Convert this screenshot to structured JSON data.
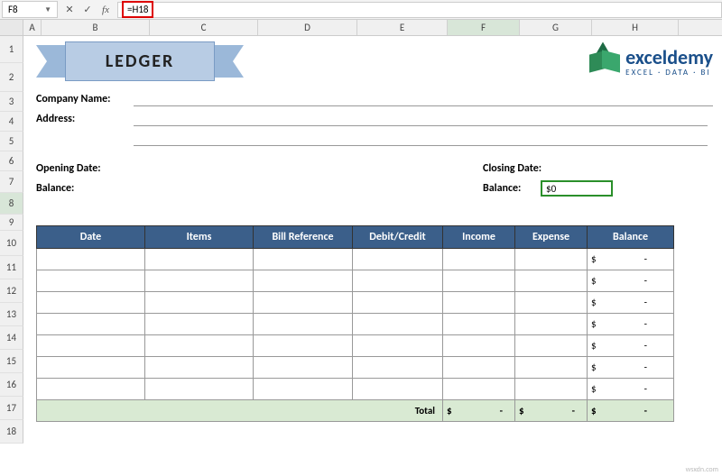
{
  "formula_bar": {
    "cell_ref": "F8",
    "formula": "=H18"
  },
  "columns": [
    "A",
    "B",
    "C",
    "D",
    "E",
    "F",
    "G",
    "H"
  ],
  "rows": [
    1,
    2,
    3,
    4,
    5,
    6,
    7,
    8,
    9,
    10,
    11,
    12,
    13,
    14,
    15,
    16,
    17,
    18
  ],
  "row_heights": {
    "1": 30,
    "2": 32,
    "3": 22,
    "4": 22,
    "5": 22,
    "6": 22,
    "7": 24,
    "8": 24,
    "9": 18,
    "10": 28,
    "11": 26,
    "12": 26,
    "13": 26,
    "14": 26,
    "15": 26,
    "16": 26,
    "17": 26,
    "18": 26
  },
  "banner": {
    "title": "LEDGER"
  },
  "logo": {
    "main": "exceldemy",
    "sub": "EXCEL · DATA · BI"
  },
  "form": {
    "company_label": "Company Name:",
    "address_label": "Address:",
    "opening_date_label": "Opening Date:",
    "balance_label": "Balance:",
    "closing_date_label": "Closing Date:",
    "closing_balance_label": "Balance:",
    "closing_balance_value": "$0"
  },
  "table": {
    "headers": [
      "Date",
      "Items",
      "Bill Reference",
      "Debit/Credit",
      "Income",
      "Expense",
      "Balance"
    ],
    "balance_placeholder": {
      "symbol": "$",
      "dash": "-"
    },
    "total_label": "Total",
    "total_cells": [
      {
        "symbol": "$",
        "dash": "-"
      },
      {
        "symbol": "$",
        "dash": "-"
      },
      {
        "symbol": "$",
        "dash": "-"
      }
    ]
  },
  "watermark": "wsxdn.com",
  "chart_data": {
    "type": "table",
    "title": "LEDGER",
    "columns": [
      "Date",
      "Items",
      "Bill Reference",
      "Debit/Credit",
      "Income",
      "Expense",
      "Balance"
    ],
    "rows": [
      {
        "Date": "",
        "Items": "",
        "Bill Reference": "",
        "Debit/Credit": "",
        "Income": "",
        "Expense": "",
        "Balance": "$ -"
      },
      {
        "Date": "",
        "Items": "",
        "Bill Reference": "",
        "Debit/Credit": "",
        "Income": "",
        "Expense": "",
        "Balance": "$ -"
      },
      {
        "Date": "",
        "Items": "",
        "Bill Reference": "",
        "Debit/Credit": "",
        "Income": "",
        "Expense": "",
        "Balance": "$ -"
      },
      {
        "Date": "",
        "Items": "",
        "Bill Reference": "",
        "Debit/Credit": "",
        "Income": "",
        "Expense": "",
        "Balance": "$ -"
      },
      {
        "Date": "",
        "Items": "",
        "Bill Reference": "",
        "Debit/Credit": "",
        "Income": "",
        "Expense": "",
        "Balance": "$ -"
      },
      {
        "Date": "",
        "Items": "",
        "Bill Reference": "",
        "Debit/Credit": "",
        "Income": "",
        "Expense": "",
        "Balance": "$ -"
      },
      {
        "Date": "",
        "Items": "",
        "Bill Reference": "",
        "Debit/Credit": "",
        "Income": "",
        "Expense": "",
        "Balance": "$ -"
      }
    ],
    "totals": {
      "Income": "$ -",
      "Expense": "$ -",
      "Balance": "$ -"
    }
  }
}
